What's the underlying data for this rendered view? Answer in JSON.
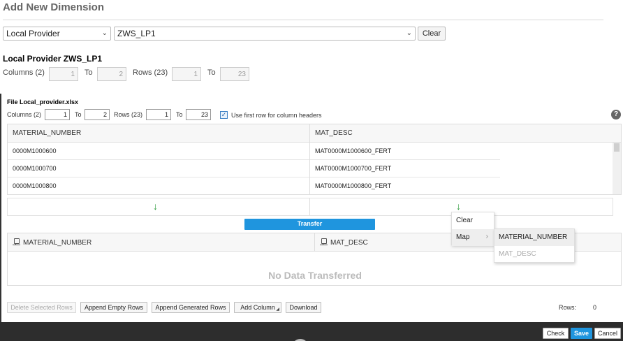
{
  "dialog": {
    "title": "Add New Dimension"
  },
  "source": {
    "provider_type": "Local Provider",
    "provider_name": "ZWS_LP1",
    "clear_label": "Clear"
  },
  "section": {
    "title": "Local Provider ZWS_LP1",
    "columns_label": "Columns (2)",
    "columns_from": "1",
    "to_label": "To",
    "columns_to": "2",
    "rows_label": "Rows (23)",
    "rows_from": "1",
    "rows_to": "23"
  },
  "file": {
    "title": "File Local_provider.xlsx",
    "columns_label": "Columns (2)",
    "columns_from": "1",
    "to_label": "To",
    "columns_to": "2",
    "rows_label": "Rows (23)",
    "rows_from": "1",
    "rows_to": "23",
    "use_first_row_label": "Use first row for column headers",
    "use_first_row_checked": true
  },
  "source_grid": {
    "headers": [
      "MATERIAL_NUMBER",
      "MAT_DESC"
    ],
    "rows": [
      [
        "0000M1000600",
        "MAT0000M1000600_FERT"
      ],
      [
        "0000M1000700",
        "MAT0000M1000700_FERT"
      ],
      [
        "0000M1000800",
        "MAT0000M1000800_FERT"
      ]
    ]
  },
  "transfer_label": "Transfer",
  "target_grid": {
    "headers": [
      "MATERIAL_NUMBER",
      "MAT_DESC"
    ],
    "empty_text": "No Data Transferred"
  },
  "context_menu": {
    "items": [
      "Clear",
      "Map"
    ],
    "submenu": [
      "MATERIAL_NUMBER",
      "MAT_DESC"
    ]
  },
  "toolbar": {
    "delete_selected": "Delete Selected Rows",
    "append_empty": "Append Empty Rows",
    "append_generated": "Append Generated Rows",
    "add_column": "Add Column",
    "download": "Download",
    "rows_label": "Rows:",
    "rows_count": "0"
  },
  "footer": {
    "check": "Check",
    "save": "Save",
    "cancel": "Cancel"
  },
  "colors": {
    "accent": "#1f95de",
    "arrow_green": "#2b9a3a",
    "footer_bg": "#2d2d2d"
  }
}
